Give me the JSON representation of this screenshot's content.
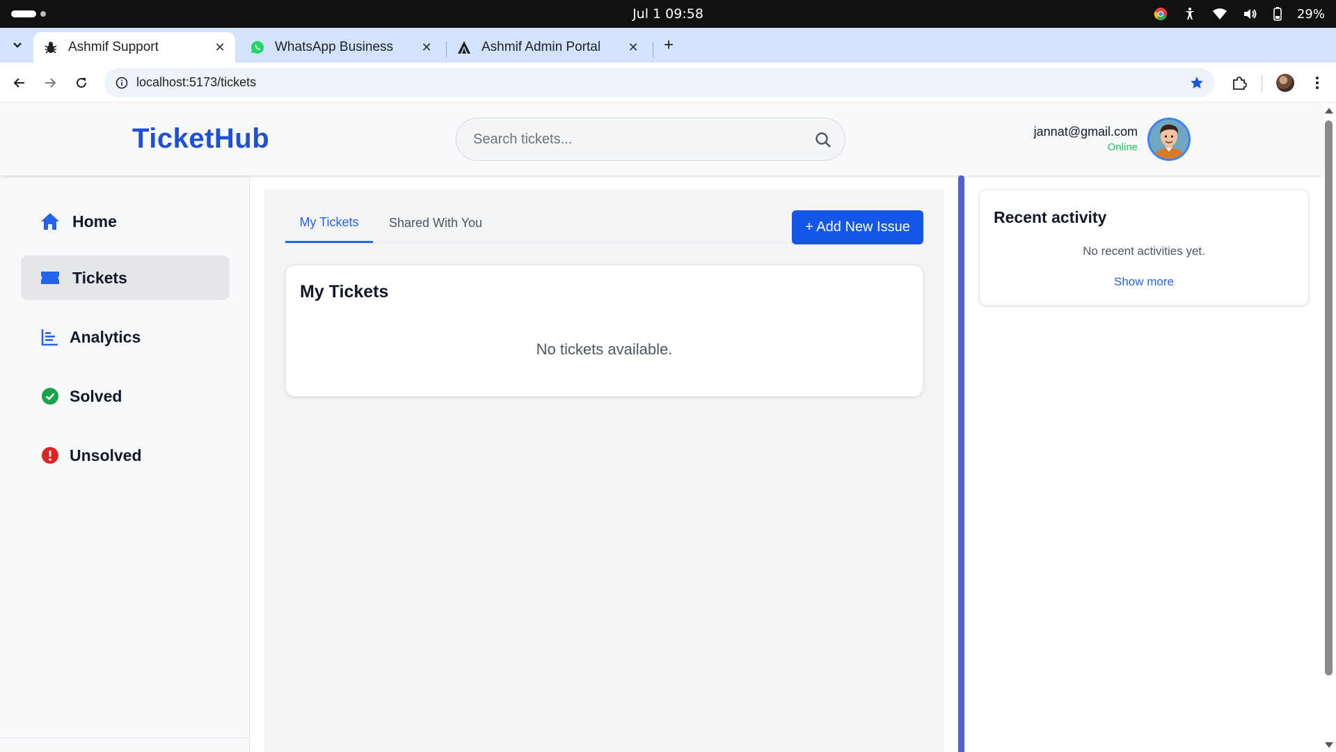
{
  "os": {
    "clock": "Jul 1  09:58",
    "battery": "29%",
    "icons": [
      "chrome-icon",
      "accessibility-icon",
      "wifi-icon",
      "volume-icon",
      "battery-icon"
    ]
  },
  "browser": {
    "tabs": [
      {
        "title": "Ashmif Support",
        "icon": "bug-icon",
        "active": true
      },
      {
        "title": "WhatsApp Business",
        "icon": "whatsapp-icon",
        "active": false
      },
      {
        "title": "Ashmif Admin Portal",
        "icon": "admin-logo-icon",
        "active": false
      }
    ],
    "url": "localhost:5173/tickets"
  },
  "header": {
    "logo": "TicketHub",
    "search_placeholder": "Search tickets...",
    "user_email": "jannat@gmail.com",
    "user_status": "Online"
  },
  "sidebar": {
    "items": [
      {
        "label": "Home",
        "icon": "home-icon"
      },
      {
        "label": "Tickets",
        "icon": "ticket-icon",
        "active": true
      },
      {
        "label": "Analytics",
        "icon": "analytics-icon"
      },
      {
        "label": "Solved",
        "icon": "check-circle-icon"
      },
      {
        "label": "Unsolved",
        "icon": "alert-circle-icon"
      }
    ]
  },
  "main": {
    "tabs": [
      {
        "label": "My Tickets",
        "active": true
      },
      {
        "label": "Shared With You",
        "active": false
      }
    ],
    "add_button": "+ Add New Issue",
    "card_title": "My Tickets",
    "empty_text": "No tickets available."
  },
  "activity": {
    "title": "Recent activity",
    "empty_text": "No recent activities yet.",
    "show_more": "Show more"
  },
  "colors": {
    "brand": "#1e4fd8",
    "primary_button": "#1456e8",
    "online": "#22c55e",
    "solved": "#16a34a",
    "unsolved": "#dc2626",
    "divider": "#4f63d2"
  }
}
